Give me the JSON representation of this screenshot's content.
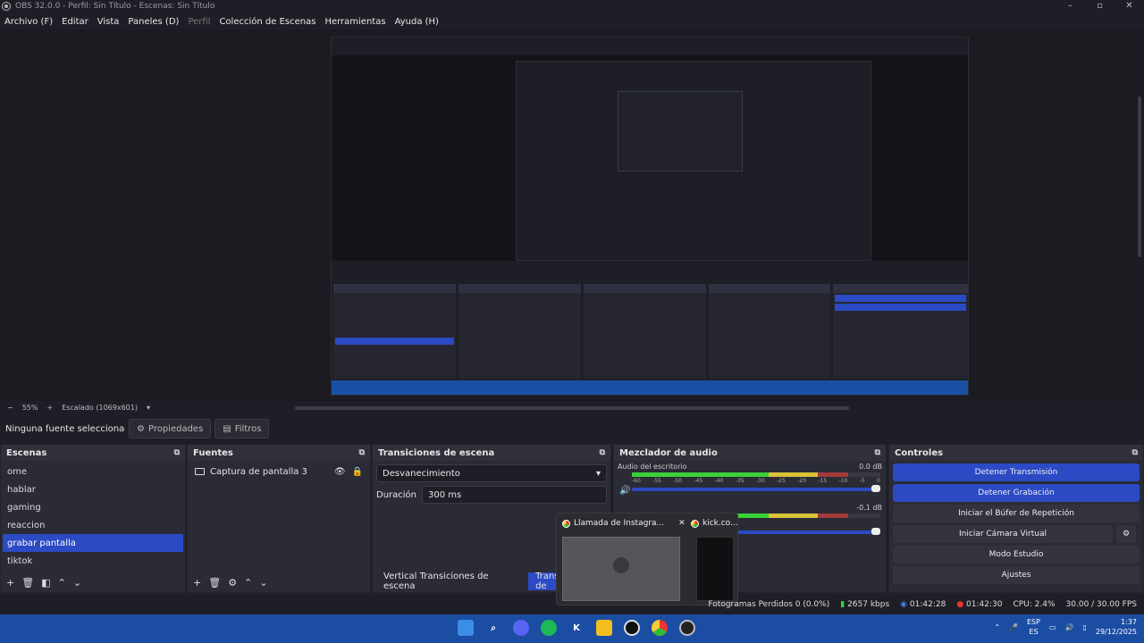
{
  "window": {
    "title": "OBS 32.0.0 - Perfil: Sin Título - Escenas: Sin Título"
  },
  "menu": [
    "Archivo (F)",
    "Editar",
    "Vista",
    "Paneles (D)",
    "Perfil",
    "Colección de Escenas",
    "Herramientas",
    "Ayuda (H)"
  ],
  "zoom": {
    "level": "55%",
    "minus": "−",
    "plus": "+",
    "scale": "Escalado (1069x601)"
  },
  "sources_toolbar": {
    "no_source": "Ninguna fuente seleccionac",
    "properties": "Propiedades",
    "filters": "Filtros"
  },
  "scenes": {
    "title": "Escenas",
    "items": [
      "ome",
      "hablar",
      "gaming",
      "reaccion",
      "grabar pantalla",
      "tiktok"
    ],
    "selected": "grabar pantalla"
  },
  "sources": {
    "title": "Fuentes",
    "items": [
      "Captura de pantalla 3"
    ]
  },
  "transitions": {
    "title": "Transiciones de escena",
    "type": "Desvanecimiento",
    "duration_label": "Duración",
    "duration": "300 ms",
    "tab_vertical": "Vertical Transiciones de escena",
    "tab_main": "Transiciones de"
  },
  "mixer": {
    "title": "Mezclador de audio",
    "ch1_name": "Audio del escritorio",
    "ch1_db": "0.0 dB",
    "ch2_db": "-0.1 dB",
    "ticks": [
      "-60",
      "-55",
      "-50",
      "-45",
      "-40",
      "-35",
      "-30",
      "-25",
      "-20",
      "-15",
      "-10",
      "-5",
      "0"
    ]
  },
  "controls": {
    "title": "Controles",
    "stop_stream": "Detener Transmisión",
    "stop_record": "Detener Grabación",
    "replay": "Iniciar el Búfer de Repetición",
    "virtualcam": "Iniciar Cámara Virtual",
    "studio": "Modo Estudio",
    "settings": "Ajustes"
  },
  "overlay": {
    "win1": "Llamada de Instagra...",
    "win2": "kick.co..."
  },
  "status": {
    "dropped": "Fotogramas Perdidos 0 (0.0%)",
    "kbps": "2657 kbps",
    "stream_time": "01:42:28",
    "rec_time": "01:42:30",
    "cpu": "CPU: 2.4%",
    "fps": "30.00 / 30.00 FPS"
  },
  "tray": {
    "lang1": "ESP",
    "lang2": "ES",
    "time": "1:37",
    "date": "29/12/2025"
  },
  "colors": {
    "accent": "#2b4ac4",
    "taskbar": "#1b4da3",
    "panel": "#2a2b34"
  }
}
